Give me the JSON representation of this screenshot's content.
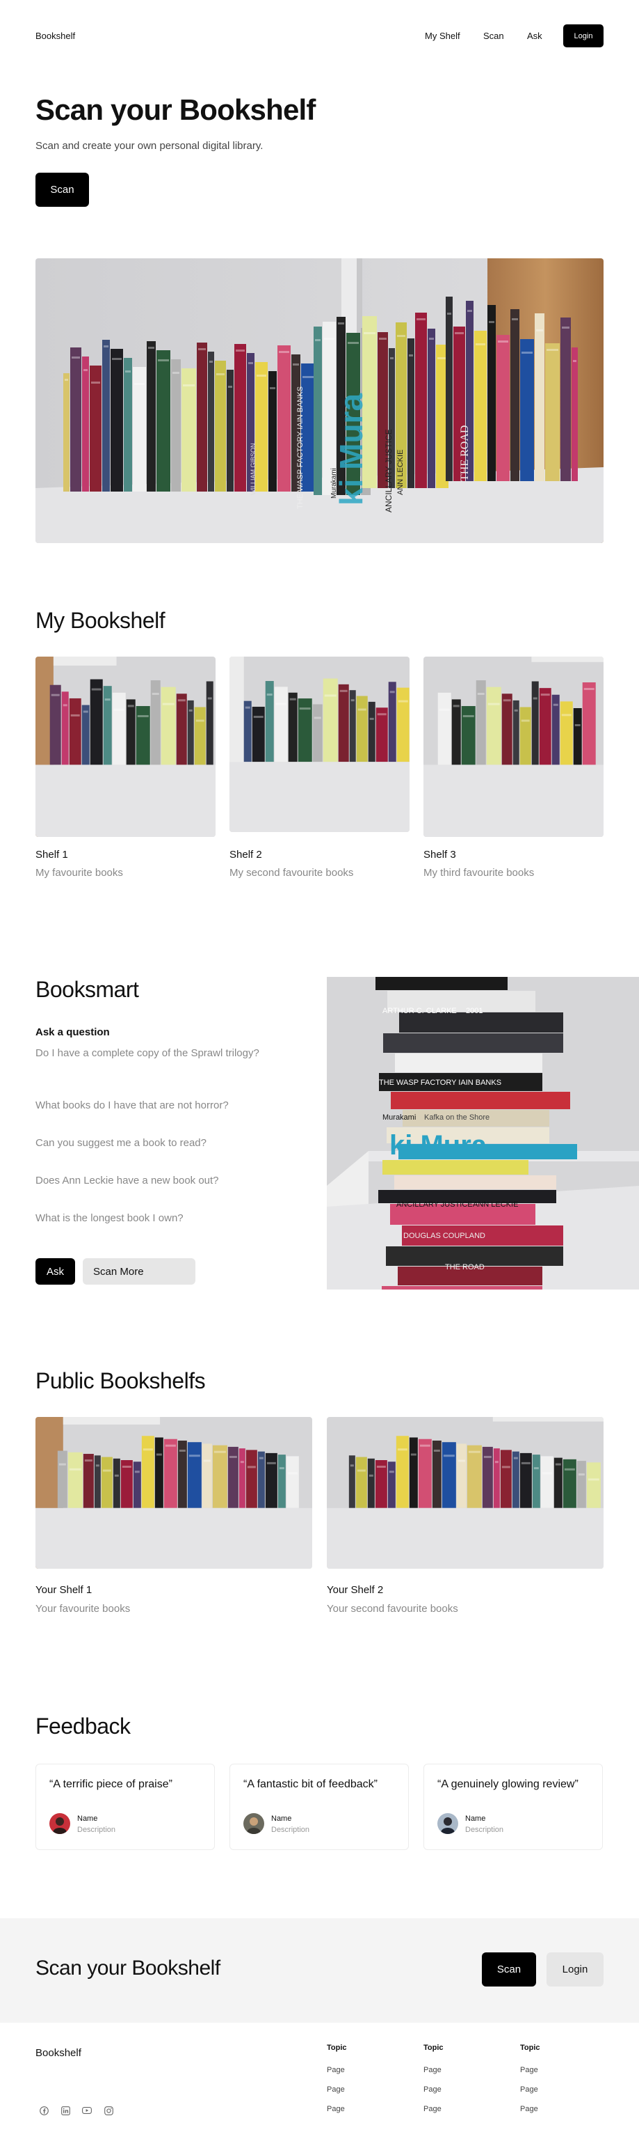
{
  "nav": {
    "brand": "Bookshelf",
    "links": [
      "My Shelf",
      "Scan",
      "Ask"
    ],
    "login": "Login"
  },
  "hero": {
    "title": "Scan your Bookshelf",
    "subtitle": "Scan and create your own personal digital library.",
    "button": "Scan"
  },
  "hero_image": {
    "icon": "bookshelf-photo",
    "spine_text": [
      "THE WASP FACTORY IAIN BANKS",
      "Murakami",
      "ANCILLARY JUSTICE",
      "ANN LECKIE",
      "THE ROAD",
      "WILLIAM GIBSON",
      "ki Mura"
    ]
  },
  "my_bookshelf": {
    "title": "My Bookshelf",
    "shelves": [
      {
        "title": "Shelf 1",
        "desc": "My favourite books"
      },
      {
        "title": "Shelf 2",
        "desc": "My second favourite books"
      },
      {
        "title": "Shelf 3",
        "desc": "My third favourite books"
      }
    ]
  },
  "booksmart": {
    "title": "Booksmart",
    "question_label": "Ask a question",
    "questions": [
      "Do I have a complete copy of the Sprawl trilogy?",
      "What books do I have that are not horror?",
      "Can you suggest me a book to read?",
      "Does Ann Leckie have a new book out?",
      "What is the longest book I own?"
    ],
    "ask_button": "Ask",
    "scan_more_button": "Scan More",
    "stack_text": [
      "ARTHUR C. CLARKE",
      "2001",
      "THE WASP FACTORY IAIN BANKS",
      "Murakami",
      "Kafka on the Shore",
      "ki Mura",
      "ANCILLARY JUSTICE",
      "ANN LECKIE",
      "DOUGLAS COUPLAND",
      "THE ROAD"
    ]
  },
  "public": {
    "title": "Public Bookshelfs",
    "shelves": [
      {
        "title": "Your Shelf 1",
        "desc": "Your favourite books"
      },
      {
        "title": "Your Shelf 2",
        "desc": "Your second favourite books"
      }
    ]
  },
  "feedback": {
    "title": "Feedback",
    "cards": [
      {
        "quote": "“A terrific piece of praise”",
        "name": "Name",
        "desc": "Description"
      },
      {
        "quote": "“A fantastic bit of feedback”",
        "name": "Name",
        "desc": "Description"
      },
      {
        "quote": "“A genuinely glowing review”",
        "name": "Name",
        "desc": "Description"
      }
    ]
  },
  "cta": {
    "title": "Scan your Bookshelf",
    "scan": "Scan",
    "login": "Login"
  },
  "footer": {
    "brand": "Bookshelf",
    "columns": [
      {
        "title": "Topic",
        "links": [
          "Page",
          "Page",
          "Page"
        ]
      },
      {
        "title": "Topic",
        "links": [
          "Page",
          "Page",
          "Page"
        ]
      },
      {
        "title": "Topic",
        "links": [
          "Page",
          "Page",
          "Page"
        ]
      }
    ],
    "social_icons": [
      "facebook-icon",
      "linkedin-icon",
      "youtube-icon",
      "instagram-icon"
    ]
  },
  "colors": {
    "accent": "#000000",
    "muted_text": "#888888",
    "band": "#f4f4f4",
    "wall": "#d4d4d6",
    "wood": "#b98a5e"
  }
}
